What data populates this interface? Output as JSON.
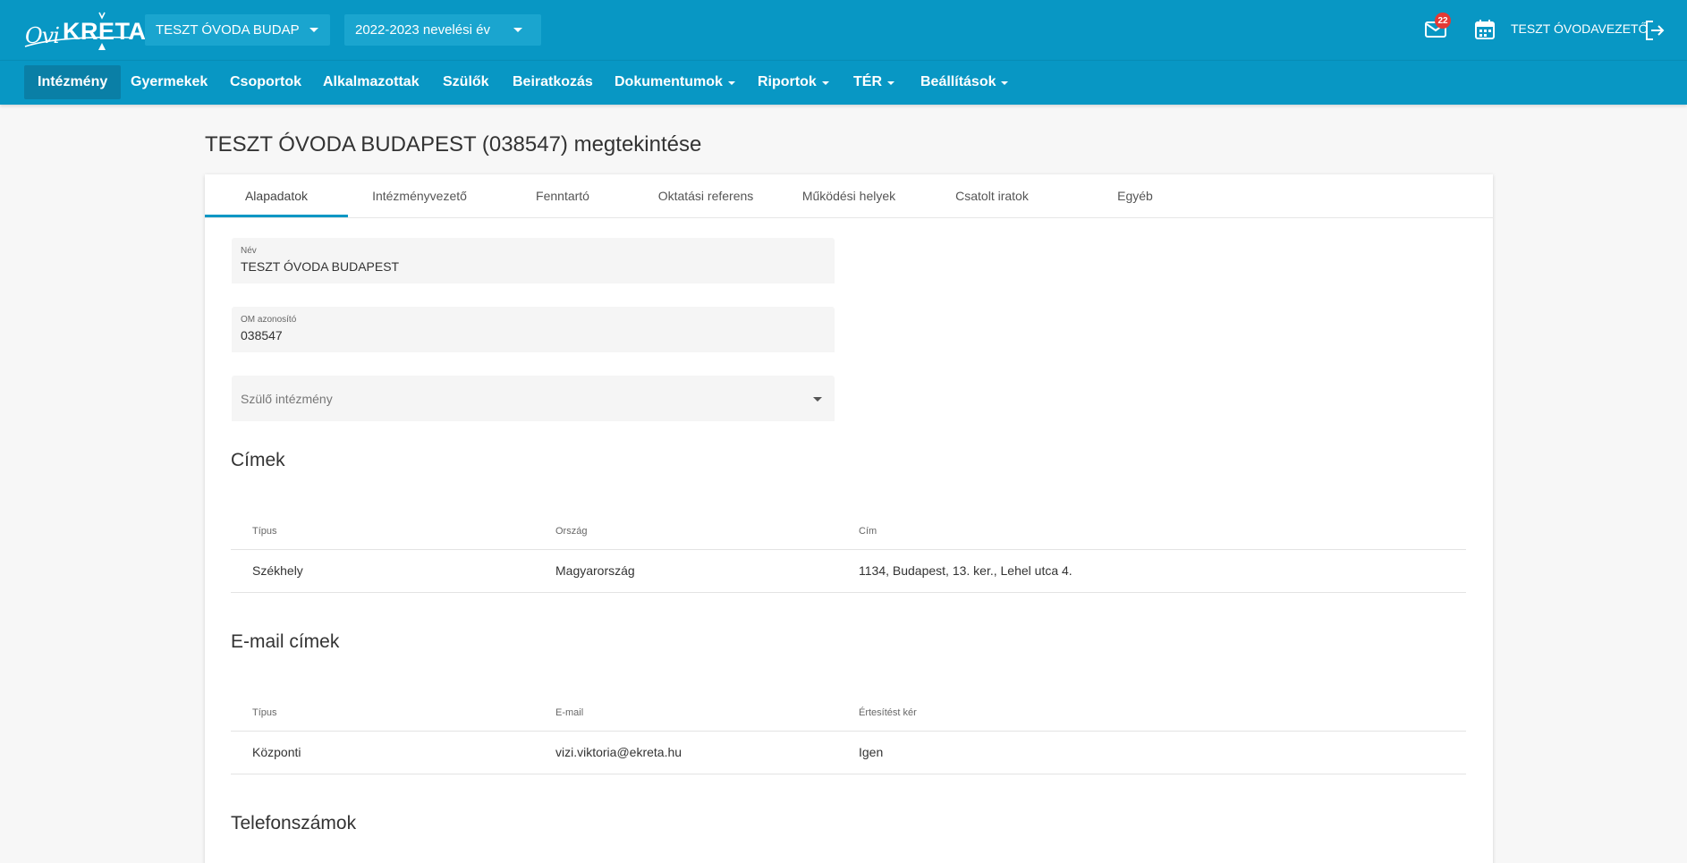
{
  "app": {
    "logo_prefix": "Ovi",
    "logo_name": "KRETA",
    "institution_select": "TESZT ÓVODA BUDAP...",
    "year_select": "2022-2023 nevelési év",
    "mail_badge": "22",
    "user_name": "TESZT ÓVODAVEZETŐ",
    "accent_color": "#0897c4"
  },
  "menu": [
    {
      "label": "Intézmény",
      "dropdown": false
    },
    {
      "label": "Gyermekek",
      "dropdown": false
    },
    {
      "label": "Csoportok",
      "dropdown": false
    },
    {
      "label": "Alkalmazottak",
      "dropdown": false
    },
    {
      "label": "Szülők",
      "dropdown": false
    },
    {
      "label": "Beiratkozás",
      "dropdown": false
    },
    {
      "label": "Dokumentumok",
      "dropdown": true
    },
    {
      "label": "Riportok",
      "dropdown": true
    },
    {
      "label": "TÉR",
      "dropdown": true
    },
    {
      "label": "Beállítások",
      "dropdown": true
    }
  ],
  "page_title": "TESZT ÓVODA BUDAPEST (038547) megtekintése",
  "tabs": [
    "Alapadatok",
    "Intézményvezető",
    "Fenntartó",
    "Oktatási referens",
    "Működési helyek",
    "Csatolt iratok",
    "Egyéb"
  ],
  "form": {
    "name_label": "Név",
    "name_value": "TESZT ÓVODA BUDAPEST",
    "om_label": "OM azonosító",
    "om_value": "038547",
    "parent_placeholder": "Szülő intézmény"
  },
  "addresses": {
    "title": "Címek",
    "headers": [
      "Típus",
      "Ország",
      "Cím"
    ],
    "rows": [
      [
        "Székhely",
        "Magyarország",
        "1134, Budapest, 13. ker., Lehel utca 4."
      ]
    ]
  },
  "emails": {
    "title": "E-mail címek",
    "headers": [
      "Típus",
      "E-mail",
      "Értesítést kér"
    ],
    "rows": [
      [
        "Központi",
        "vizi.viktoria@ekreta.hu",
        "Igen"
      ]
    ]
  },
  "phones": {
    "title": "Telefonszámok"
  }
}
